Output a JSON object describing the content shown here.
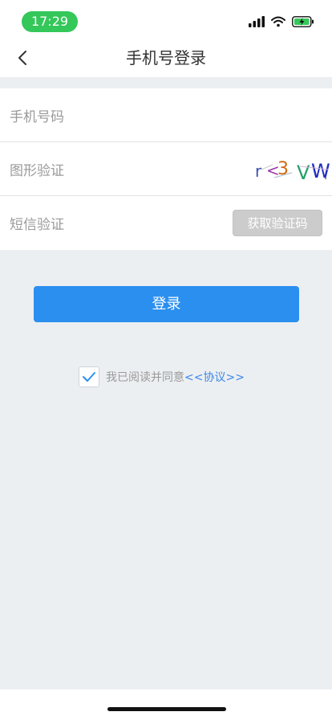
{
  "status_bar": {
    "time": "17:29"
  },
  "nav": {
    "title": "手机号登录"
  },
  "form": {
    "phone_label": "手机号码",
    "captcha_label": "图形验证",
    "sms_label": "短信验证",
    "sms_button": "获取验证码"
  },
  "login": {
    "button_label": "登录"
  },
  "agreement": {
    "text": "我已阅读并同意",
    "link_label": "<<协议>>",
    "checked": true
  },
  "colors": {
    "accent": "#2b8ff0",
    "time_pill": "#34c759",
    "background": "#eceff2",
    "link": "#3b89e8"
  },
  "icons": [
    "back-arrow-icon",
    "signal-icon",
    "wifi-icon",
    "battery-charging-icon",
    "checkmark-icon"
  ]
}
